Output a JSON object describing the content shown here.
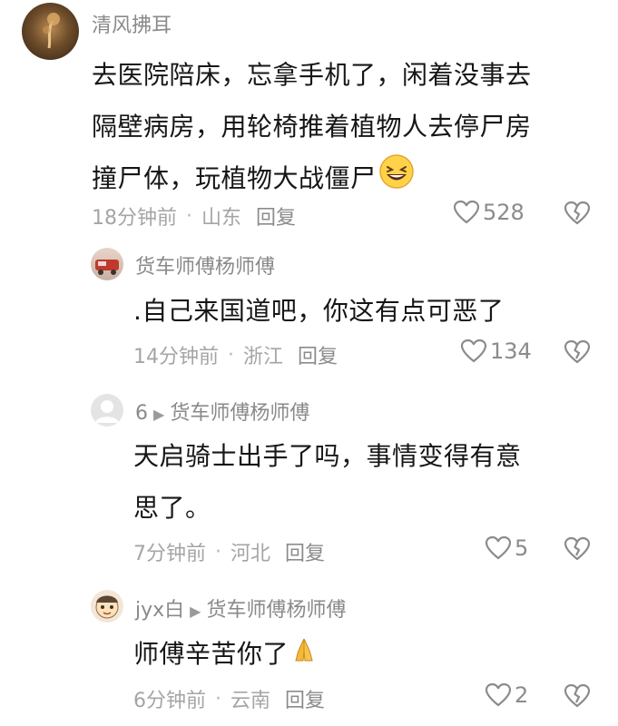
{
  "comments": [
    {
      "username": "清风拂耳",
      "reply_to": "",
      "text_lines": [
        "去医院陪床，忘拿手机了，闲着没事去",
        "隔壁病房，用轮椅推着植物人去停尸房",
        "撞尸体，玩植物大战僵尸"
      ],
      "time": "18分钟前",
      "location": "山东",
      "reply_label": "回复",
      "likes": "528"
    },
    {
      "username": "货车师傅杨师傅",
      "reply_to": "",
      "text_lines": [
        ".自己来国道吧，你这有点可恶了"
      ],
      "time": "14分钟前",
      "location": "浙江",
      "reply_label": "回复",
      "likes": "134"
    },
    {
      "username": "6",
      "reply_to": "货车师傅杨师傅",
      "text_lines": [
        "天启骑士出手了吗，事情变得有意",
        "思了。"
      ],
      "time": "7分钟前",
      "location": "河北",
      "reply_label": "回复",
      "likes": "5"
    },
    {
      "username": "jyx白",
      "reply_to": "货车师傅杨师傅",
      "text_lines": [
        "师傅辛苦你了"
      ],
      "time": "6分钟前",
      "location": "云南",
      "reply_label": "回复",
      "likes": "2"
    }
  ],
  "icons": {
    "like": "heart-outline-icon",
    "dislike": "broken-heart-icon",
    "reply_arrow": "triangle-right-icon",
    "emoji_1": "grinning-squint-emoji",
    "emoji_2": "folded-hands-emoji"
  },
  "colors": {
    "username": "#8a8a8a",
    "body": "#161616",
    "meta": "#a5a5a5",
    "icon": "#8b8b8b",
    "background": "#ffffff"
  }
}
